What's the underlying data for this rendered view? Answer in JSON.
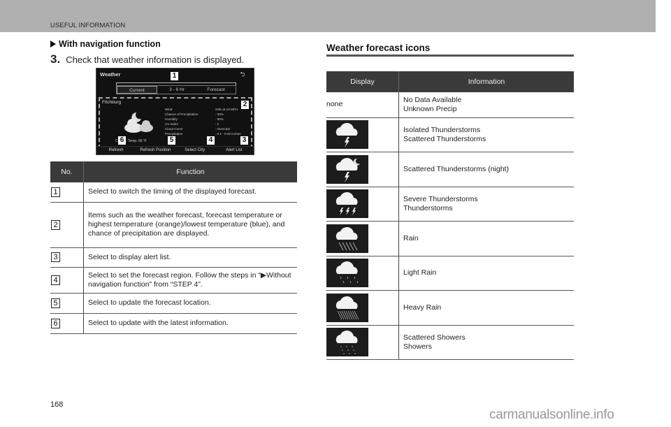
{
  "header": {
    "section_label": "USEFUL INFORMATION"
  },
  "left": {
    "heading": "With navigation function",
    "step_number": "3.",
    "step_text": "Check that weather information is displayed.",
    "screen": {
      "title": "Weather",
      "back_icon": "back-arrow-icon",
      "status_text": "",
      "tabs": [
        "Current",
        "3 - 6 Hr",
        "Forecast"
      ],
      "active_tab": "Current",
      "city": "Fitchburg",
      "details": [
        {
          "key": "Wind",
          "value": "SSE at 10 MPH"
        },
        {
          "key": "Chance of Precipitation",
          "value": ": 30%"
        },
        {
          "key": "Humidity",
          "value": ": 90%"
        },
        {
          "key": "UV Index",
          "value": ": 2"
        },
        {
          "key": "Cloud Cover",
          "value": ": Overcast"
        },
        {
          "key": "Precipitation",
          "value": ": 0.1 - 0.25 inches"
        }
      ],
      "current_temp": "Current Temp: 66 °F",
      "buttons": [
        "Refresh",
        "Refresh Position",
        "Select City",
        "Alert List"
      ],
      "callouts": [
        "1",
        "2",
        "3",
        "4",
        "5",
        "6"
      ]
    },
    "table": {
      "headers": [
        "No.",
        "Function"
      ],
      "rows": [
        {
          "no": "1",
          "text": "Select to switch the timing of the displayed forecast."
        },
        {
          "no": "2",
          "text": "Items such as the weather forecast, forecast temperature or highest temperature (orange)/lowest temperature (blue), and chance of precipitation are displayed."
        },
        {
          "no": "3",
          "text": "Select to display alert list."
        },
        {
          "no": "4",
          "text": "Select to set the forecast region. Follow the steps in “▶Without navigation function” from “STEP 4”."
        },
        {
          "no": "5",
          "text": "Select to update the forecast location."
        },
        {
          "no": "6",
          "text": "Select to update with the latest information."
        }
      ]
    }
  },
  "right": {
    "heading": "Weather forecast icons",
    "table": {
      "headers": [
        "Display",
        "Information"
      ],
      "rows": [
        {
          "display": "none",
          "icon": "",
          "lines": [
            "No Data Available",
            "Unknown Precip"
          ]
        },
        {
          "display": "",
          "icon": "cloud-lightning-icon",
          "lines": [
            "Isolated Thunderstorms",
            "Scattered Thunderstorms"
          ]
        },
        {
          "display": "",
          "icon": "cloud-moon-lightning-icon",
          "lines": [
            "Scattered Thunderstorms (night)"
          ]
        },
        {
          "display": "",
          "icon": "cloud-multi-lightning-icon",
          "lines": [
            "Severe Thunderstorms",
            "Thunderstorms"
          ]
        },
        {
          "display": "",
          "icon": "cloud-rain-icon",
          "lines": [
            "Rain"
          ]
        },
        {
          "display": "",
          "icon": "cloud-light-rain-icon",
          "lines": [
            "Light Rain"
          ]
        },
        {
          "display": "",
          "icon": "cloud-heavy-rain-icon",
          "lines": [
            "Heavy Rain"
          ]
        },
        {
          "display": "",
          "icon": "cloud-showers-icon",
          "lines": [
            "Scattered Showers",
            "Showers"
          ]
        }
      ]
    }
  },
  "footer": {
    "page_number": "168",
    "watermark": "carmanualsonline.info"
  }
}
